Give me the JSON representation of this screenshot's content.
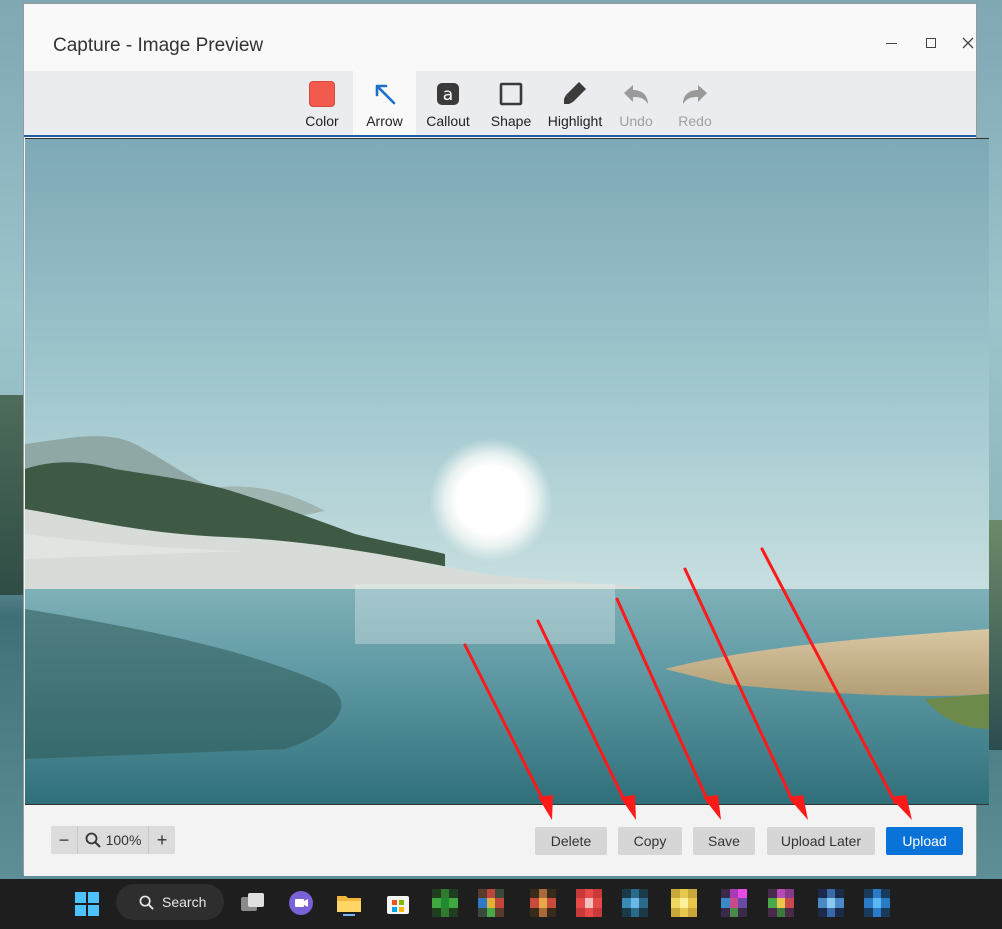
{
  "window": {
    "title": "Capture - Image Preview"
  },
  "toolbar": {
    "tools": [
      {
        "label": "Color",
        "icon": "color-swatch-icon",
        "color": "#f25a4d"
      },
      {
        "label": "Arrow",
        "icon": "arrow-icon",
        "active": true
      },
      {
        "label": "Callout",
        "icon": "callout-icon"
      },
      {
        "label": "Shape",
        "icon": "shape-square-icon"
      },
      {
        "label": "Highlight",
        "icon": "highlighter-icon"
      },
      {
        "label": "Undo",
        "icon": "undo-icon",
        "disabled": true
      },
      {
        "label": "Redo",
        "icon": "redo-icon",
        "disabled": true
      }
    ]
  },
  "zoom": {
    "minus": "−",
    "value": "100%",
    "plus": "+"
  },
  "actions": {
    "delete": "Delete",
    "copy": "Copy",
    "save": "Save",
    "upload_later": "Upload Later",
    "upload": "Upload"
  },
  "taskbar": {
    "search_label": "Search"
  },
  "colors": {
    "accent": "#0a73d9",
    "annotation_arrow": "#ff1a1a",
    "selected_color": "#f25a4d"
  }
}
